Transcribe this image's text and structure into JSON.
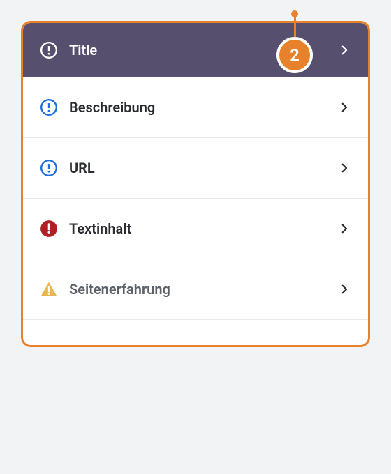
{
  "annotation": {
    "number": "2"
  },
  "header": {
    "icon": "alert-circle-outline",
    "label": "Title"
  },
  "rows": [
    {
      "icon": "alert-circle-outline-blue",
      "label": "Beschreibung",
      "muted": false
    },
    {
      "icon": "alert-circle-outline-blue",
      "label": "URL",
      "muted": false
    },
    {
      "icon": "alert-circle-solid-red",
      "label": "Textinhalt",
      "muted": false
    },
    {
      "icon": "alert-triangle-amber",
      "label": "Seitenerfahrung",
      "muted": true
    }
  ],
  "colors": {
    "accent": "#e8812b",
    "header_bg": "#56506e",
    "blue": "#1d6fe0",
    "red": "#b01f24",
    "amber": "#eab54b"
  }
}
